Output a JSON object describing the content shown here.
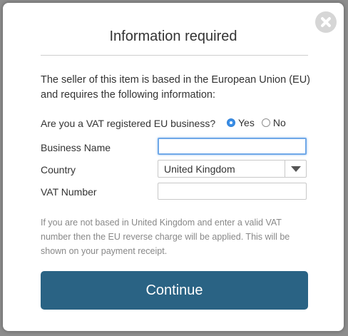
{
  "dialog": {
    "title": "Information required",
    "intro": "The seller of this item is based in the European Union (EU) and requires the following information:",
    "close_icon": "close-icon"
  },
  "vat": {
    "question": "Are you a VAT registered EU business?",
    "options": [
      "Yes",
      "No"
    ],
    "selected": "Yes"
  },
  "fields": {
    "business_name_label": "Business Name",
    "business_name_value": "",
    "country_label": "Country",
    "country_value": "United Kingdom",
    "vat_number_label": "VAT Number",
    "vat_number_value": ""
  },
  "note": "If you are not based in United Kingdom and enter a valid VAT number then the EU reverse charge will be applied. This will be shown on your payment receipt.",
  "actions": {
    "continue_label": "Continue"
  },
  "colors": {
    "primary_button": "#2a6384",
    "radio_selected": "#3a8ee6",
    "focus_ring": "#6fa8e8"
  }
}
